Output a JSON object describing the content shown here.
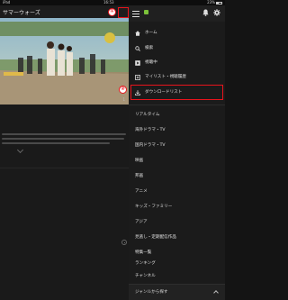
{
  "status_bar": {
    "device": "iPad",
    "time": "16:53",
    "battery": "23%"
  },
  "left": {
    "title": "サマーウォーズ",
    "hero_number": "1"
  },
  "annotations": {
    "callout_1": "①",
    "callout_2": "②"
  },
  "drawer": {
    "username": "",
    "primary_items": [
      {
        "label": "ホーム",
        "icon": "home-icon"
      },
      {
        "label": "検索",
        "icon": "search-icon"
      },
      {
        "label": "視聴中",
        "icon": "play-icon"
      },
      {
        "label": "マイリスト・視聴履歴",
        "icon": "mylist-icon"
      },
      {
        "label": "ダウンロードリスト",
        "icon": "download-icon"
      }
    ],
    "category_items": [
      "リアルタイム",
      "海外ドラマ・TV",
      "国内ドラマ・TV",
      "映画",
      "邦画",
      "アニメ",
      "キッズ・ファミリー",
      "アジア",
      "見逃し・定期配信作品",
      "特集一覧",
      "ランキング",
      "チャンネル"
    ],
    "bottom_label": "ジャンルから探す"
  },
  "colors": {
    "accent": "#e8141c",
    "avatar": "#7cc23a"
  }
}
